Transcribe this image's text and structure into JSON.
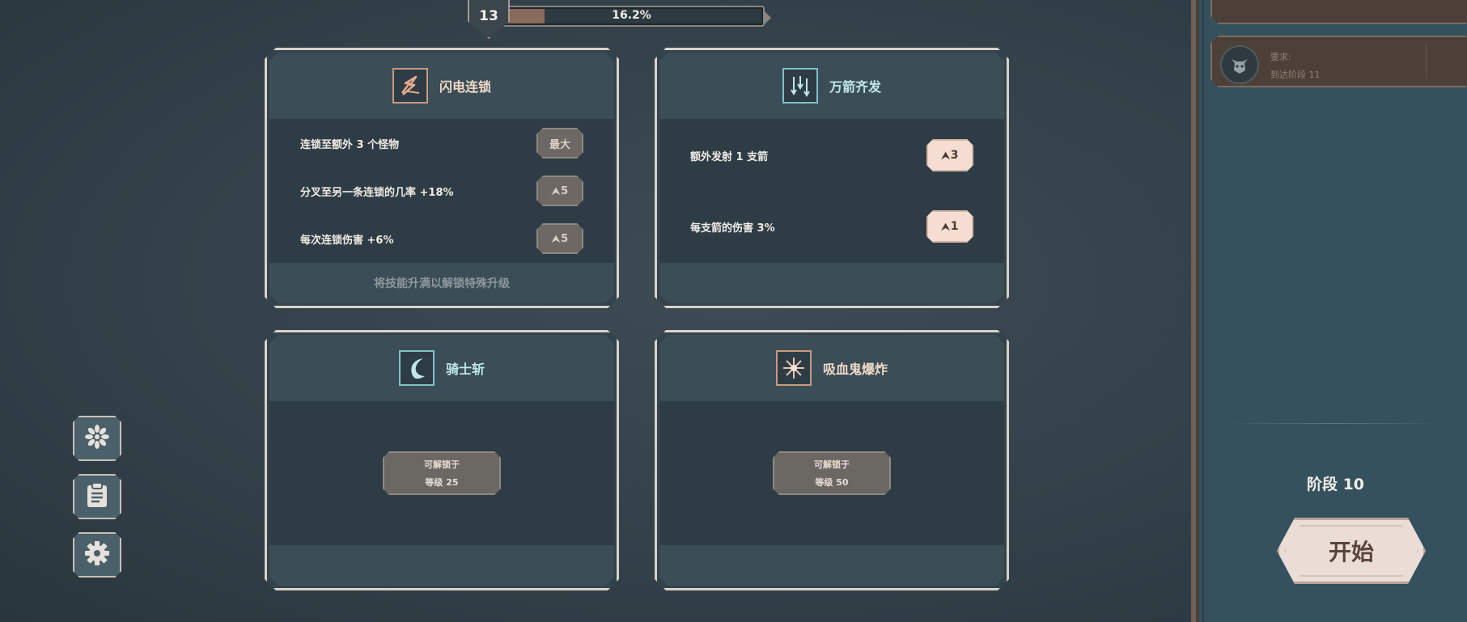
{
  "hud": {
    "level": "13",
    "xp_percent_label": "16.2%",
    "xp_fraction": 0.162
  },
  "cards": {
    "lightning": {
      "title": "闪电连锁",
      "icon": "lightning-chain-icon",
      "rows": [
        {
          "text": "连锁至额外 3 个怪物",
          "badge": "最大"
        },
        {
          "text": "分叉至另一条连锁的几率 +18%",
          "badge": "5"
        },
        {
          "text": "每次连锁伤害 +6%",
          "badge": "5"
        }
      ],
      "footer": "将技能升满以解锁特殊升级"
    },
    "arrows": {
      "title": "万箭齐发",
      "icon": "arrow-volley-icon",
      "rows": [
        {
          "text": "额外发射 1 支箭",
          "badge": "3"
        },
        {
          "text": "每支箭的伤害 3%",
          "badge": "1"
        }
      ]
    },
    "knight": {
      "title": "骑士斩",
      "icon": "crescent-slash-icon",
      "unlock_label": "可解锁于",
      "unlock_level": "等级 25"
    },
    "vampire": {
      "title": "吸血鬼爆炸",
      "icon": "burst-explosion-icon",
      "unlock_label": "可解锁于",
      "unlock_level": "等级 50"
    }
  },
  "side_buttons": [
    "flower-icon",
    "clipboard-icon",
    "gear-icon"
  ],
  "right_panel": {
    "slot": {
      "line1": "要求:",
      "line2": "到达阶段 11"
    },
    "stage": "阶段 10",
    "start": "开始"
  },
  "colors": {
    "background": "#33414a",
    "card_border": "#d9d2c8",
    "accent_orange": "#c89a80",
    "accent_cyan": "#7cc3c8",
    "start_button": "#e9ddd6"
  }
}
